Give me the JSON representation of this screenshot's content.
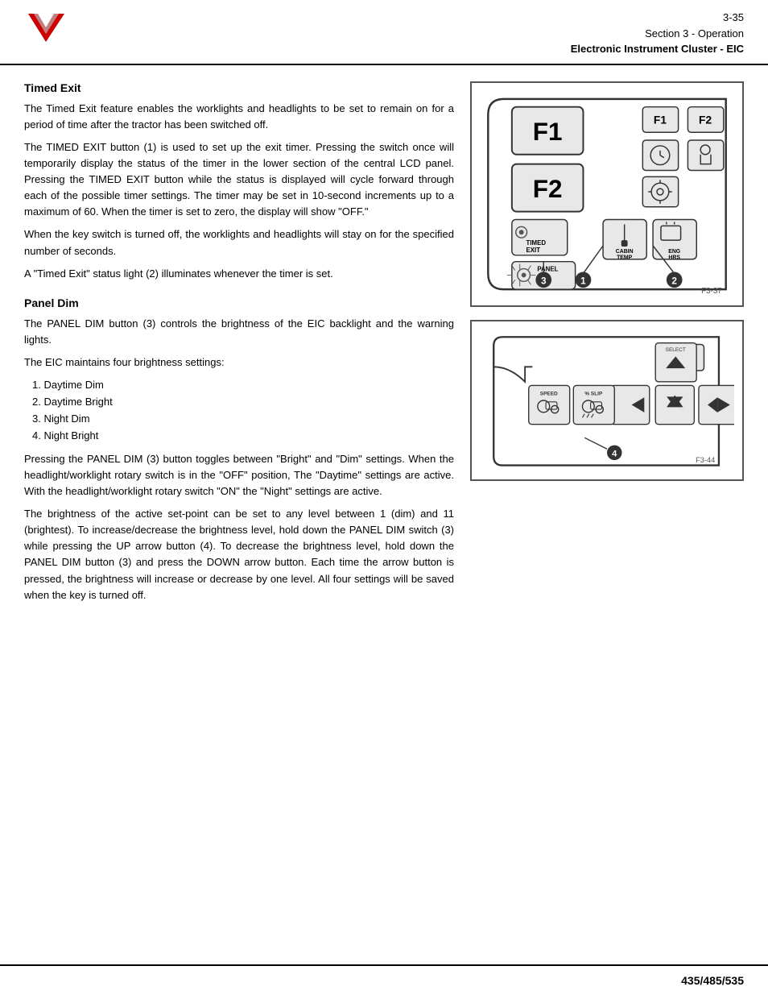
{
  "header": {
    "page_number": "3-35",
    "section": "Section 3 - Operation",
    "subtitle": "Electronic Instrument Cluster - EIC"
  },
  "timed_exit": {
    "heading": "Timed Exit",
    "para1": "The Timed Exit feature enables the worklights and headlights to be set to remain on for a period of time after the tractor has been switched off.",
    "para2": "The TIMED EXIT button (1) is used to set up the exit timer. Pressing the switch once will temporarily display the status of the timer in the lower section of the central LCD panel. Pressing the TIMED EXIT button while the status is displayed will cycle forward through each of the possible timer settings. The timer may be set in 10-second increments up to a maximum of 60. When the timer is set to zero, the display will show \"OFF.\"",
    "para3": "When the key switch is turned off, the worklights and headlights will stay on for the specified number of seconds.",
    "para4": "A \"Timed Exit\" status light (2) illuminates whenever the timer is set."
  },
  "panel_dim": {
    "heading": "Panel Dim",
    "para1": "The PANEL DIM button (3) controls the brightness of the EIC backlight and the warning lights.",
    "para2": "The EIC maintains four brightness settings:",
    "list": [
      "1. Daytime Dim",
      "2. Daytime Bright",
      "3. Night Dim",
      "4. Night Bright"
    ],
    "para3": "Pressing the PANEL DIM (3) button toggles between \"Bright\" and \"Dim\" settings. When the headlight/worklight rotary switch is in the \"OFF\" position, The \"Daytime\" settings are active. With the headlight/worklight rotary switch \"ON\" the \"Night\" settings are active.",
    "para4": "The brightness of the active set-point can be set to any level between 1 (dim) and 11 (brightest). To increase/decrease the brightness level, hold down the PANEL DIM switch (3) while pressing the UP arrow button (4). To decrease the brightness level, hold down the PANEL DIM button (3) and press the DOWN arrow button. Each time the arrow button is pressed, the brightness will increase or decrease by one level. All four settings will be saved when the key is turned off."
  },
  "figures": {
    "fig1_label": "F3-37",
    "fig2_label": "F3-44"
  },
  "footer": {
    "model": "435/485/535"
  }
}
